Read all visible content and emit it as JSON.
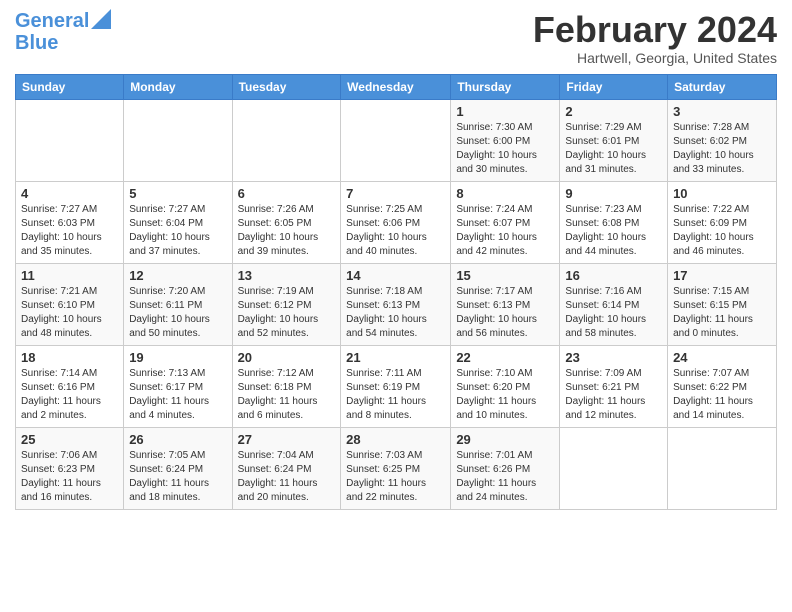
{
  "header": {
    "logo_line1": "General",
    "logo_line2": "Blue",
    "month": "February 2024",
    "location": "Hartwell, Georgia, United States"
  },
  "weekdays": [
    "Sunday",
    "Monday",
    "Tuesday",
    "Wednesday",
    "Thursday",
    "Friday",
    "Saturday"
  ],
  "weeks": [
    [
      {
        "day": "",
        "info": ""
      },
      {
        "day": "",
        "info": ""
      },
      {
        "day": "",
        "info": ""
      },
      {
        "day": "",
        "info": ""
      },
      {
        "day": "1",
        "info": "Sunrise: 7:30 AM\nSunset: 6:00 PM\nDaylight: 10 hours\nand 30 minutes."
      },
      {
        "day": "2",
        "info": "Sunrise: 7:29 AM\nSunset: 6:01 PM\nDaylight: 10 hours\nand 31 minutes."
      },
      {
        "day": "3",
        "info": "Sunrise: 7:28 AM\nSunset: 6:02 PM\nDaylight: 10 hours\nand 33 minutes."
      }
    ],
    [
      {
        "day": "4",
        "info": "Sunrise: 7:27 AM\nSunset: 6:03 PM\nDaylight: 10 hours\nand 35 minutes."
      },
      {
        "day": "5",
        "info": "Sunrise: 7:27 AM\nSunset: 6:04 PM\nDaylight: 10 hours\nand 37 minutes."
      },
      {
        "day": "6",
        "info": "Sunrise: 7:26 AM\nSunset: 6:05 PM\nDaylight: 10 hours\nand 39 minutes."
      },
      {
        "day": "7",
        "info": "Sunrise: 7:25 AM\nSunset: 6:06 PM\nDaylight: 10 hours\nand 40 minutes."
      },
      {
        "day": "8",
        "info": "Sunrise: 7:24 AM\nSunset: 6:07 PM\nDaylight: 10 hours\nand 42 minutes."
      },
      {
        "day": "9",
        "info": "Sunrise: 7:23 AM\nSunset: 6:08 PM\nDaylight: 10 hours\nand 44 minutes."
      },
      {
        "day": "10",
        "info": "Sunrise: 7:22 AM\nSunset: 6:09 PM\nDaylight: 10 hours\nand 46 minutes."
      }
    ],
    [
      {
        "day": "11",
        "info": "Sunrise: 7:21 AM\nSunset: 6:10 PM\nDaylight: 10 hours\nand 48 minutes."
      },
      {
        "day": "12",
        "info": "Sunrise: 7:20 AM\nSunset: 6:11 PM\nDaylight: 10 hours\nand 50 minutes."
      },
      {
        "day": "13",
        "info": "Sunrise: 7:19 AM\nSunset: 6:12 PM\nDaylight: 10 hours\nand 52 minutes."
      },
      {
        "day": "14",
        "info": "Sunrise: 7:18 AM\nSunset: 6:13 PM\nDaylight: 10 hours\nand 54 minutes."
      },
      {
        "day": "15",
        "info": "Sunrise: 7:17 AM\nSunset: 6:13 PM\nDaylight: 10 hours\nand 56 minutes."
      },
      {
        "day": "16",
        "info": "Sunrise: 7:16 AM\nSunset: 6:14 PM\nDaylight: 10 hours\nand 58 minutes."
      },
      {
        "day": "17",
        "info": "Sunrise: 7:15 AM\nSunset: 6:15 PM\nDaylight: 11 hours\nand 0 minutes."
      }
    ],
    [
      {
        "day": "18",
        "info": "Sunrise: 7:14 AM\nSunset: 6:16 PM\nDaylight: 11 hours\nand 2 minutes."
      },
      {
        "day": "19",
        "info": "Sunrise: 7:13 AM\nSunset: 6:17 PM\nDaylight: 11 hours\nand 4 minutes."
      },
      {
        "day": "20",
        "info": "Sunrise: 7:12 AM\nSunset: 6:18 PM\nDaylight: 11 hours\nand 6 minutes."
      },
      {
        "day": "21",
        "info": "Sunrise: 7:11 AM\nSunset: 6:19 PM\nDaylight: 11 hours\nand 8 minutes."
      },
      {
        "day": "22",
        "info": "Sunrise: 7:10 AM\nSunset: 6:20 PM\nDaylight: 11 hours\nand 10 minutes."
      },
      {
        "day": "23",
        "info": "Sunrise: 7:09 AM\nSunset: 6:21 PM\nDaylight: 11 hours\nand 12 minutes."
      },
      {
        "day": "24",
        "info": "Sunrise: 7:07 AM\nSunset: 6:22 PM\nDaylight: 11 hours\nand 14 minutes."
      }
    ],
    [
      {
        "day": "25",
        "info": "Sunrise: 7:06 AM\nSunset: 6:23 PM\nDaylight: 11 hours\nand 16 minutes."
      },
      {
        "day": "26",
        "info": "Sunrise: 7:05 AM\nSunset: 6:24 PM\nDaylight: 11 hours\nand 18 minutes."
      },
      {
        "day": "27",
        "info": "Sunrise: 7:04 AM\nSunset: 6:24 PM\nDaylight: 11 hours\nand 20 minutes."
      },
      {
        "day": "28",
        "info": "Sunrise: 7:03 AM\nSunset: 6:25 PM\nDaylight: 11 hours\nand 22 minutes."
      },
      {
        "day": "29",
        "info": "Sunrise: 7:01 AM\nSunset: 6:26 PM\nDaylight: 11 hours\nand 24 minutes."
      },
      {
        "day": "",
        "info": ""
      },
      {
        "day": "",
        "info": ""
      }
    ]
  ]
}
